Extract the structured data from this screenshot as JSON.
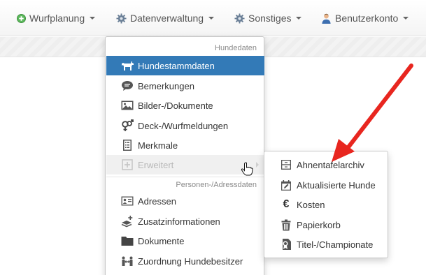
{
  "nav": {
    "items": [
      {
        "label": "Wurfplanung",
        "icon": "plus-circle-icon"
      },
      {
        "label": "Datenverwaltung",
        "icon": "gear-icon"
      },
      {
        "label": "Sonstiges",
        "icon": "gear-icon"
      },
      {
        "label": "Benutzerkonto",
        "icon": "user-icon"
      }
    ]
  },
  "dropdown": {
    "header1": "Hundedaten",
    "items1": [
      {
        "label": "Hundestammdaten",
        "icon": "dog-icon",
        "state": "active"
      },
      {
        "label": "Bemerkungen",
        "icon": "speech-bubble-icon"
      },
      {
        "label": "Bilder-/Dokumente",
        "icon": "picture-icon"
      },
      {
        "label": "Deck-/Wurfmeldungen",
        "icon": "gender-icon"
      },
      {
        "label": "Merkmale",
        "icon": "checklist-icon"
      },
      {
        "label": "Erweitert",
        "icon": "plus-square-icon",
        "state": "hover"
      }
    ],
    "header2": "Personen-/Adressdaten",
    "items2": [
      {
        "label": "Adressen",
        "icon": "address-card-icon"
      },
      {
        "label": "Zusatzinformationen",
        "icon": "layers-plus-icon"
      },
      {
        "label": "Dokumente",
        "icon": "folder-icon"
      },
      {
        "label": "Zuordnung Hundebesitzer",
        "icon": "people-link-icon"
      }
    ]
  },
  "submenu": {
    "items": [
      {
        "label": "Ahnentafelarchiv",
        "icon": "archive-icon"
      },
      {
        "label": "Aktualisierte Hunde",
        "icon": "calendar-edit-icon"
      },
      {
        "label": "Kosten",
        "icon": "euro-icon"
      },
      {
        "label": "Papierkorb",
        "icon": "trash-icon"
      },
      {
        "label": "Titel-/Championate",
        "icon": "award-icon"
      }
    ]
  },
  "colors": {
    "accent": "#337ab7",
    "arrow": "#e8261f"
  }
}
